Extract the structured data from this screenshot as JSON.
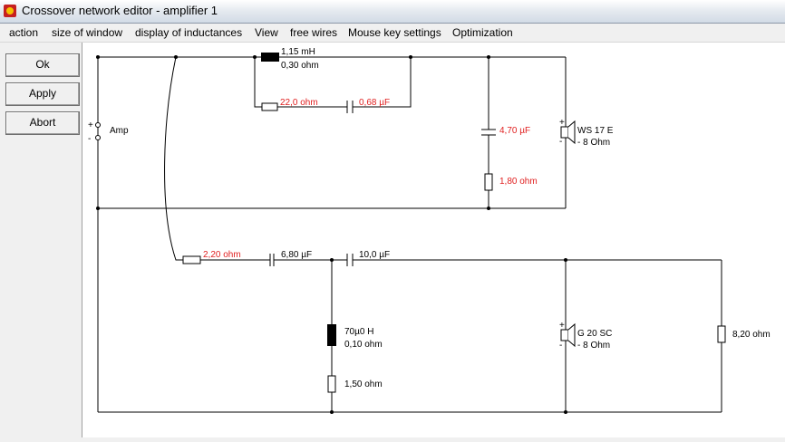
{
  "window": {
    "title": "Crossover network editor - amplifier 1"
  },
  "menu": [
    "action",
    "size of window",
    "display of inductances",
    "View",
    "free wires",
    "Mouse key settings",
    "Optimization"
  ],
  "buttons": {
    "ok": "Ok",
    "apply": "Apply",
    "abort": "Abort"
  },
  "amp": {
    "label": "Amp",
    "plus": "+",
    "minus": "-"
  },
  "upper": {
    "l1_value": "1,15 mH",
    "l1_res": "0,30 ohm",
    "r_series": "22,0 ohm",
    "c_series": "0,68 µF",
    "c_shunt": "4,70 µF",
    "r_shunt": "1,80 ohm",
    "speaker_name": "WS 17 E",
    "speaker_imp": "- 8 Ohm"
  },
  "lower": {
    "r_in": "2,20 ohm",
    "c1": "6,80 µF",
    "c2": "10,0 µF",
    "l_value": "70µ0 H",
    "l_res": "0,10 ohm",
    "r_l": "1,50 ohm",
    "speaker_name": "G 20 SC",
    "speaker_imp": "- 8 Ohm",
    "r_load": "8,20 ohm"
  },
  "colors": {
    "red_value": "#e02020",
    "wire": "#000000"
  }
}
